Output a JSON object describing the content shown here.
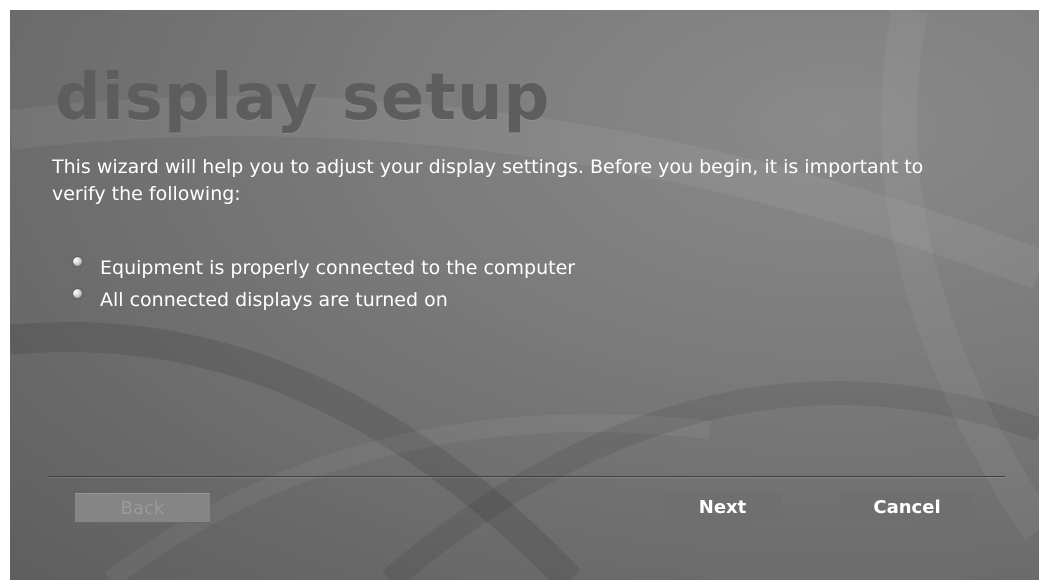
{
  "wizard": {
    "title": "display setup",
    "intro": "This wizard will help you to adjust your display settings. Before you begin, it is important to verify the following:",
    "checklist": [
      {
        "label": "Equipment is properly connected to the computer"
      },
      {
        "label": "All connected displays are turned on"
      }
    ],
    "buttons": {
      "back_label": "Back",
      "back_enabled": false,
      "next_label": "Next",
      "cancel_label": "Cancel"
    }
  },
  "colors": {
    "background": "#7a7a7a",
    "title": "#5d5d5d",
    "text": "#ffffff",
    "button": "#6f6f6f",
    "button_disabled": "#858585"
  },
  "icons": {
    "bullet": "round-bullet-icon"
  }
}
